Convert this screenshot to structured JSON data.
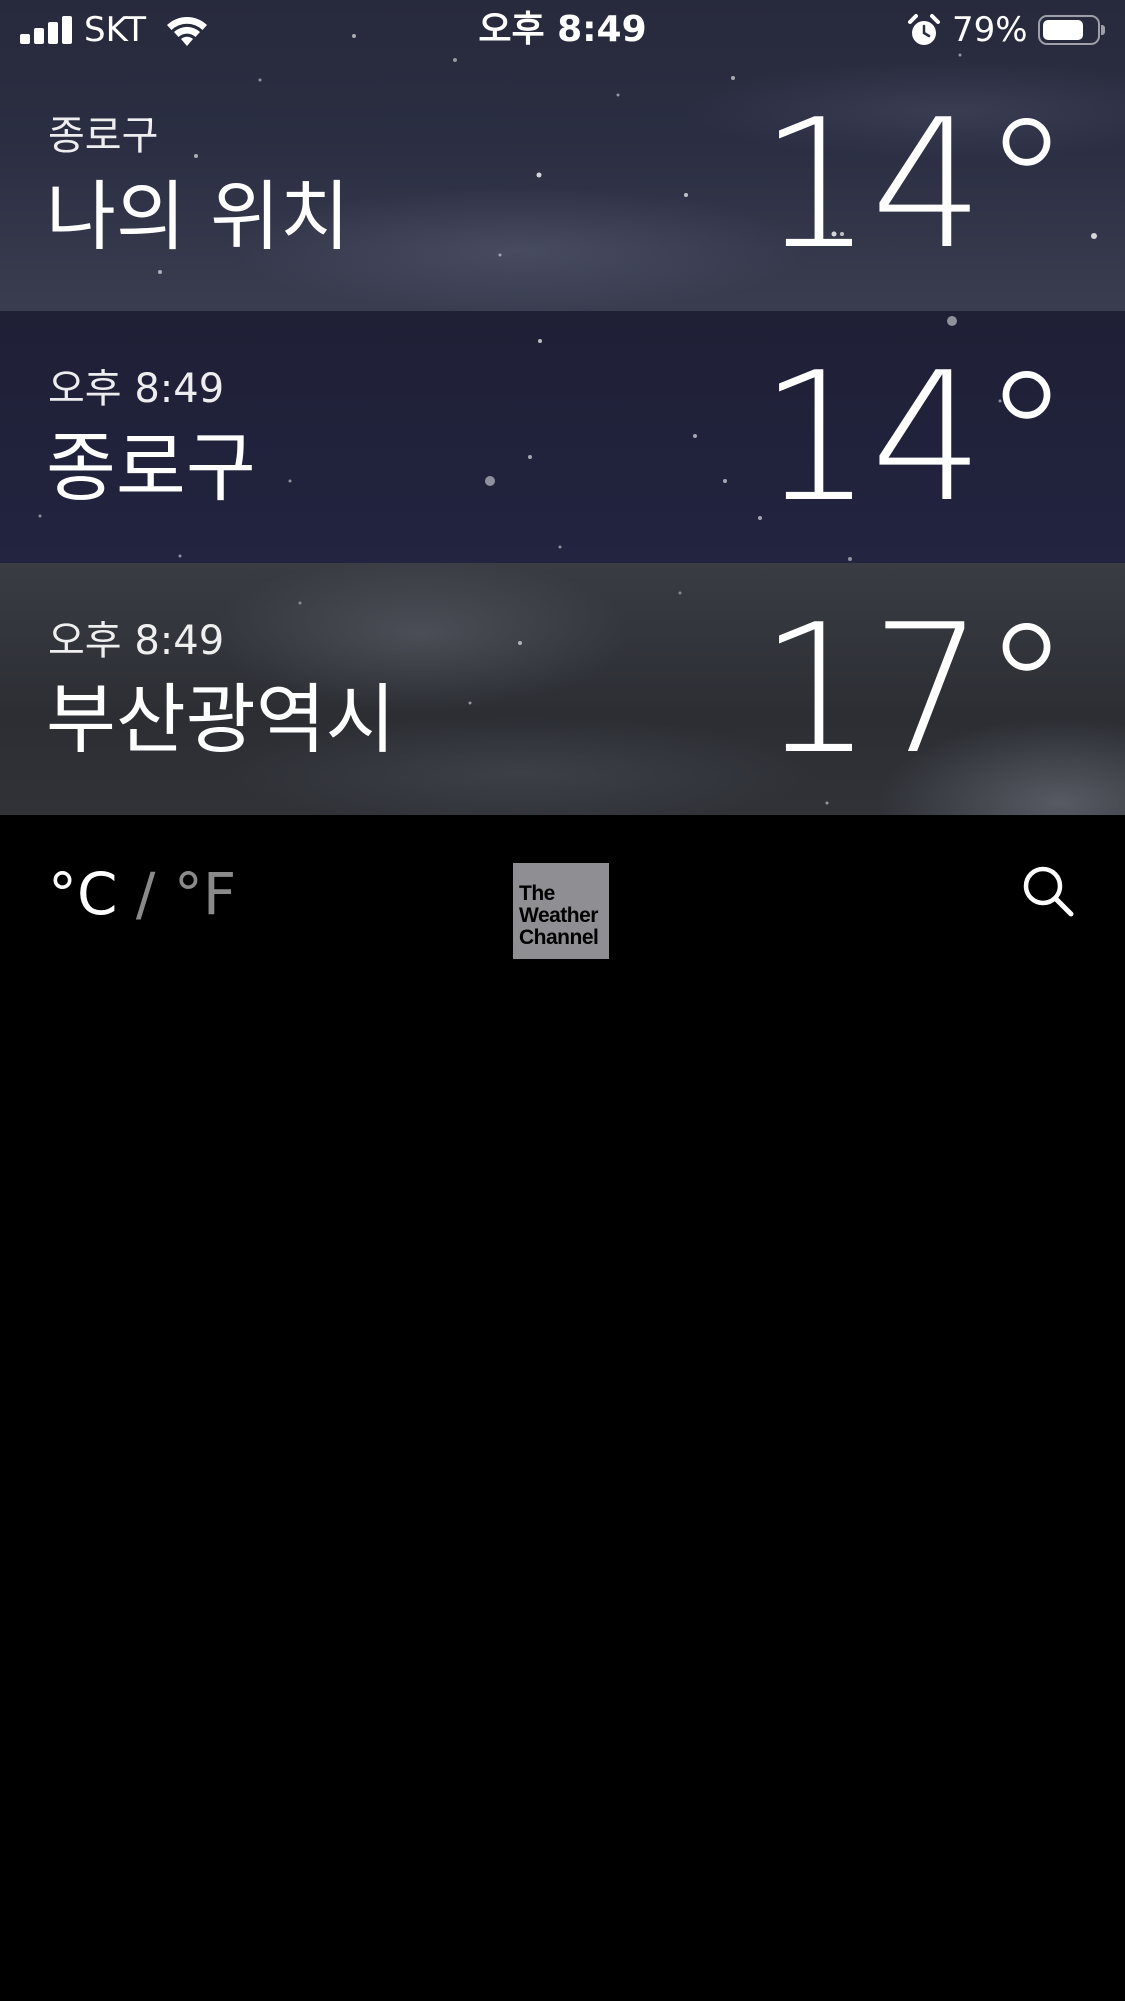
{
  "status_bar": {
    "carrier": "SKT",
    "time": "오후 8:49",
    "battery_percent": "79%",
    "battery_level": 0.79,
    "icons": [
      "signal-icon",
      "wifi-icon",
      "alarm-icon",
      "battery-icon"
    ]
  },
  "cities": [
    {
      "subtitle": "종로구",
      "name": "나의 위치",
      "temperature": "14°"
    },
    {
      "subtitle": "오후 8:49",
      "name": "종로구",
      "temperature": "14°"
    },
    {
      "subtitle": "오후 8:49",
      "name": "부산광역시",
      "temperature": "17°"
    }
  ],
  "footer": {
    "unit_celsius": "°C",
    "unit_separator": " / ",
    "unit_fahrenheit": "°F",
    "active_unit": "celsius",
    "logo_lines": [
      "The",
      "Weather",
      "Channel"
    ],
    "search_icon": "search-icon"
  },
  "colors": {
    "background": "#000000",
    "inactive_unit": "#8a8a8a",
    "logo_bg": "#8e8e93"
  }
}
